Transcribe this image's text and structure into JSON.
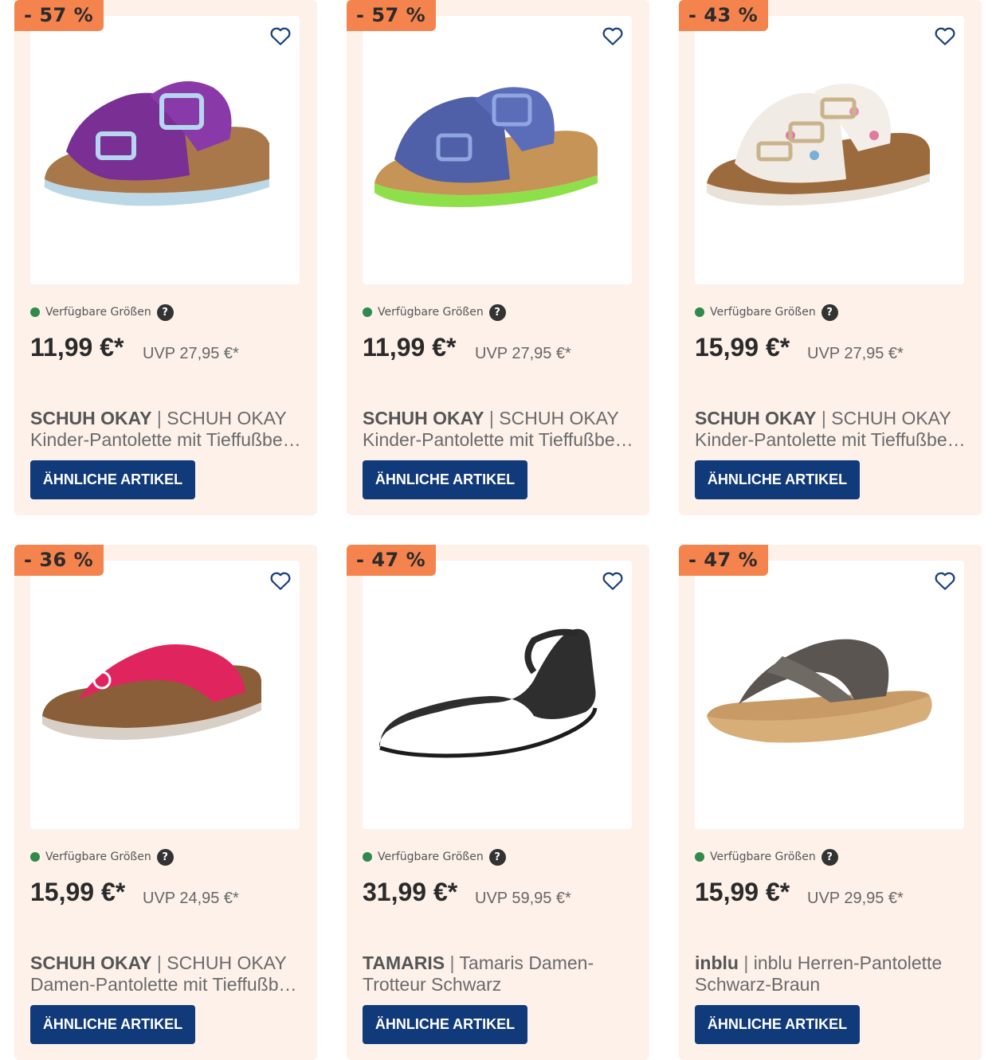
{
  "labels": {
    "available_sizes": "Verfügbare Größen",
    "help": "?",
    "similar_button": "ÄHNLICHE ARTIKEL",
    "separator": "|"
  },
  "products": [
    {
      "discount": "- 57 %",
      "price": "11,99 €*",
      "uvp": "UVP 27,95 €*",
      "brand": "SCHUH OKAY",
      "name_line1": "SCHUH OKAY",
      "name_line2": "Kinder-Pantolette mit Tieffußbett…",
      "image": "purple-kids-buckle-sandal"
    },
    {
      "discount": "- 57 %",
      "price": "11,99 €*",
      "uvp": "UVP 27,95 €*",
      "brand": "SCHUH OKAY",
      "name_line1": "SCHUH OKAY",
      "name_line2": "Kinder-Pantolette mit Tieffußbett…",
      "image": "blue-kids-buckle-sandal"
    },
    {
      "discount": "- 43 %",
      "price": "15,99 €*",
      "uvp": "UVP 27,95 €*",
      "brand": "SCHUH OKAY",
      "name_line1": "SCHUH OKAY",
      "name_line2": "Kinder-Pantolette mit Tieffußbett…",
      "image": "white-three-strap-sandal"
    },
    {
      "discount": "- 36 %",
      "price": "15,99 €*",
      "uvp": "UVP 24,95 €*",
      "brand": "SCHUH OKAY",
      "name_line1": "SCHUH OKAY",
      "name_line2": "Damen-Pantolette mit Tieffußbett…",
      "image": "pink-toe-post-sandal"
    },
    {
      "discount": "- 47 %",
      "price": "31,99 €*",
      "uvp": "UVP 59,95 €*",
      "brand": "TAMARIS",
      "name_line1": "Tamaris Damen-",
      "name_line2": "Trotteur Schwarz",
      "image": "black-ankle-strap-flat"
    },
    {
      "discount": "- 47 %",
      "price": "15,99 €*",
      "uvp": "UVP 29,95 €*",
      "brand": "inblu",
      "name_line1": "inblu Herren-Pantolette",
      "name_line2": "Schwarz-Braun",
      "image": "brown-cross-strap-slide"
    }
  ],
  "colors": {
    "card_bg": "#fdf1ea",
    "badge": "#f5834e",
    "button": "#113a7a",
    "available_dot": "#2f8a4b"
  }
}
